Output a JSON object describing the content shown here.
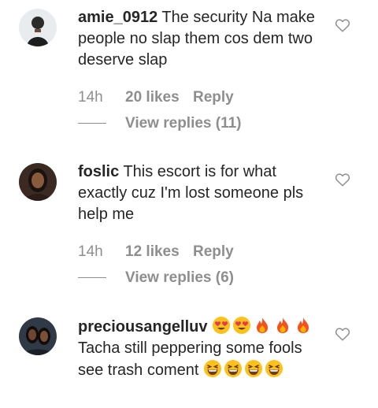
{
  "comments": [
    {
      "username": "amie_0912",
      "text": "The security Na make people no slap them cos dem two deserve slap",
      "time": "14h",
      "likes": "20 likes",
      "reply": "Reply",
      "view_replies": "View replies (11)",
      "avatar_icon": "avatar-photo",
      "like_icon": "heart-outline-icon"
    },
    {
      "username": "foslic",
      "text": "This escort is for what exactly cuz I'm lost someone pls help me",
      "time": "14h",
      "likes": "12 likes",
      "reply": "Reply",
      "view_replies": "View replies (6)",
      "avatar_icon": "avatar-photo",
      "like_icon": "heart-outline-icon"
    },
    {
      "username": "preciousangelluv",
      "text": "Tacha still peppering some fools see trash coment",
      "emojis_before": [
        "heart-eyes-emoji",
        "heart-eyes-emoji",
        "fire-emoji",
        "fire-emoji",
        "fire-emoji"
      ],
      "emojis_after": [
        "grinning-squinting-emoji",
        "grinning-squinting-emoji",
        "grinning-squinting-emoji",
        "grinning-squinting-emoji"
      ],
      "avatar_icon": "avatar-photo",
      "like_icon": "heart-outline-icon"
    }
  ],
  "colors": {
    "text": "#262626",
    "meta": "#8e8e8e",
    "background": "#ffffff"
  }
}
